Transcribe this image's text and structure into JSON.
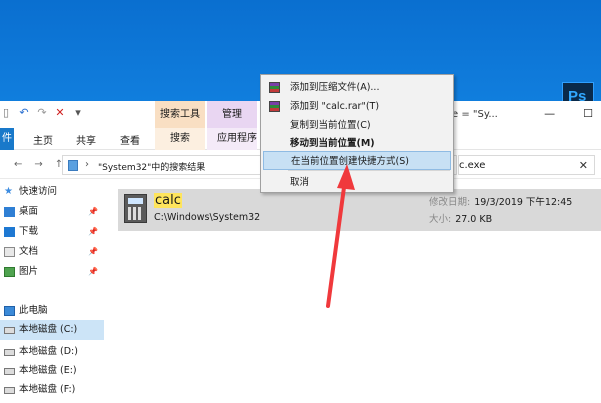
{
  "desktop": {
    "ps_label": "Ps"
  },
  "window": {
    "context_tabs": {
      "search": "搜索工具",
      "manage": "管理"
    },
    "title_path": "e = \"Sy...",
    "controls": {
      "minimize": "—",
      "maximize": "☐"
    },
    "ribbon": {
      "file": "件",
      "home": "主页",
      "share": "共享",
      "view": "查看",
      "search": "搜索",
      "manage": "应用程序工"
    },
    "nav": {
      "back": "←",
      "forward": "→",
      "up": "↑"
    },
    "address": {
      "chevron": "›",
      "text": "\"System32\"中的搜索结果"
    },
    "search": {
      "value": "c.exe",
      "clear": "✕"
    },
    "sidebar": {
      "quick_access": "快速访问",
      "desktop": "桌面",
      "downloads": "下载",
      "documents": "文档",
      "pictures": "图片",
      "this_pc": "此电脑",
      "drive_c": "本地磁盘 (C:)",
      "drive_d": "本地磁盘 (D:)",
      "drive_e": "本地磁盘 (E:)",
      "drive_f": "本地磁盘 (F:)"
    },
    "result": {
      "name": "calc",
      "path": "C:\\Windows\\System32",
      "modified_label": "修改日期:",
      "modified_value": "19/3/2019 下午12:45",
      "size_label": "大小:",
      "size_value": "27.0 KB"
    }
  },
  "context_menu": {
    "items": [
      "添加到压缩文件(A)...",
      "添加到 \"calc.rar\"(T)",
      "复制到当前位置(C)",
      "移动到当前位置(M)",
      "在当前位置创建快捷方式(S)",
      "取消"
    ],
    "highlighted_index": 4
  },
  "colors": {
    "accent": "#1979ca",
    "highlight": "#c7e0f4",
    "arrow": "#f0393c",
    "name_highlight": "#ffe55c"
  }
}
